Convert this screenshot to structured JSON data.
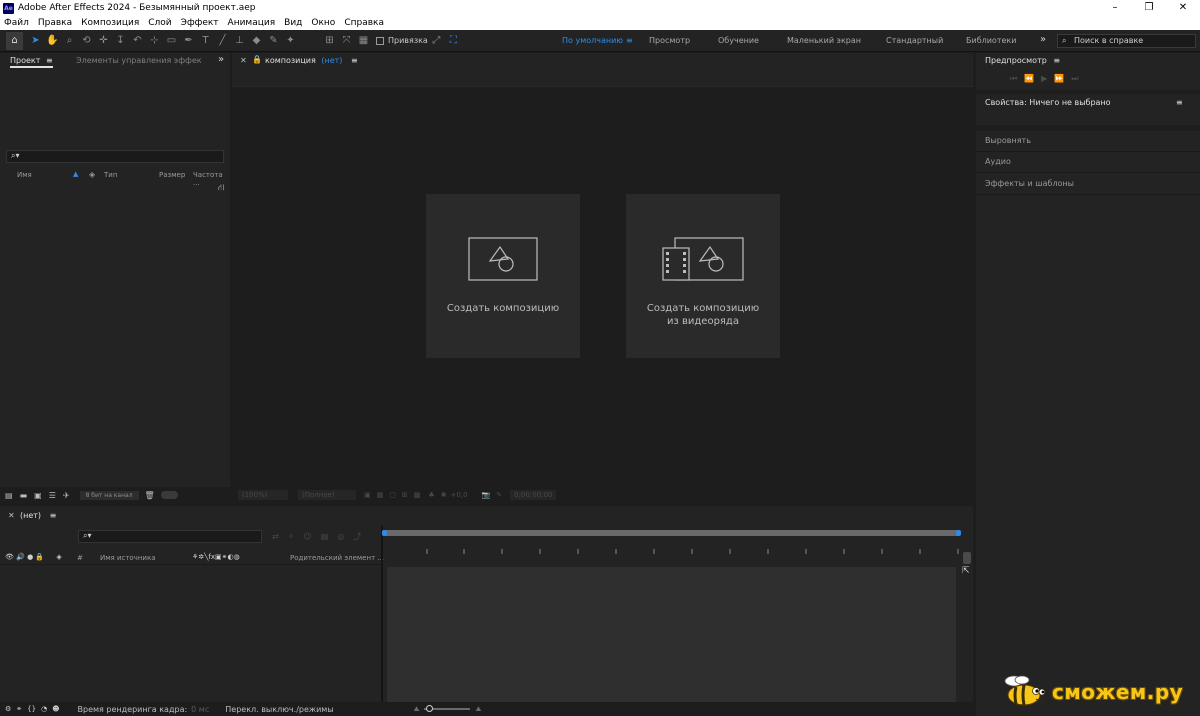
{
  "window": {
    "title": "Adobe After Effects 2024 - Безымянный проект.aep",
    "app_badge": "Ae",
    "controls": [
      "–",
      "❐",
      "✕"
    ]
  },
  "menu": [
    "Файл",
    "Правка",
    "Композиция",
    "Слой",
    "Эффект",
    "Анимация",
    "Вид",
    "Окно",
    "Справка"
  ],
  "toolbar": {
    "snap_label": "Привязка",
    "workspaces": [
      "По умолчанию",
      "Просмотр",
      "Обучение",
      "Маленький экран",
      "Стандартный",
      "Библиотеки"
    ],
    "active_workspace": "По умолчанию",
    "overflow": "»",
    "help_search_placeholder": "Поиск в справке"
  },
  "project_panel": {
    "tab_project": "Проект",
    "tab_effects": "Элементы управления эффектами",
    "columns": [
      "Имя",
      "Тип",
      "Размер",
      "Частота ..."
    ],
    "bit_depth": "8 бит на канал"
  },
  "comp_panel": {
    "tab_prefix": "композиция",
    "tab_value": "(нет)",
    "card_new_comp": "Создать композицию",
    "card_from_footage_line1": "Создать композицию",
    "card_from_footage_line2": "из видеоряда",
    "zoom": "(100%)",
    "resolution": "(Полное)",
    "exposure": "+0,0",
    "timecode": "0;00;00;00"
  },
  "right_panel": {
    "preview": "Предпросмотр",
    "properties": "Свойства: Ничего не выбрано",
    "align": "Выровнять",
    "audio": "Аудио",
    "effects": "Эффекты и шаблоны"
  },
  "timeline": {
    "tab": "(нет)",
    "col_hash": "#",
    "col_source": "Имя источника",
    "col_parent": "Родительский элемент ...",
    "render_time_label": "Время рендеринга кадра:",
    "render_time_value": "0 мс",
    "toggle_label": "Перекл. выключ./режимы"
  },
  "watermark": {
    "text": "сможем.ру"
  },
  "colors": {
    "accent": "#2d8ceb",
    "bg": "#1d1d1d",
    "panel": "#232323",
    "card": "#2a2a2a"
  }
}
